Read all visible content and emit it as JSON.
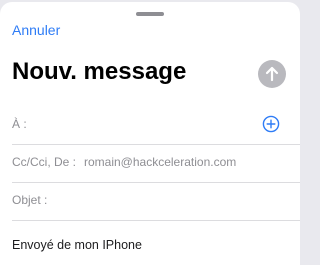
{
  "header": {
    "cancel_label": "Annuler",
    "title": "Nouv. message"
  },
  "fields": {
    "to_label": "À :",
    "cc_label": "Cc/Cci, De :",
    "from_email": "romain@hackceleration.com",
    "subject_label": "Objet :"
  },
  "body": {
    "signature": "Envoyé de mon IPhone"
  },
  "icons": {
    "send": "arrow-up-icon",
    "add_recipient": "plus-circle-icon"
  },
  "colors": {
    "accent": "#2e7cf6",
    "send_disabled": "#b9b9be",
    "field_label": "#8e8e93"
  }
}
